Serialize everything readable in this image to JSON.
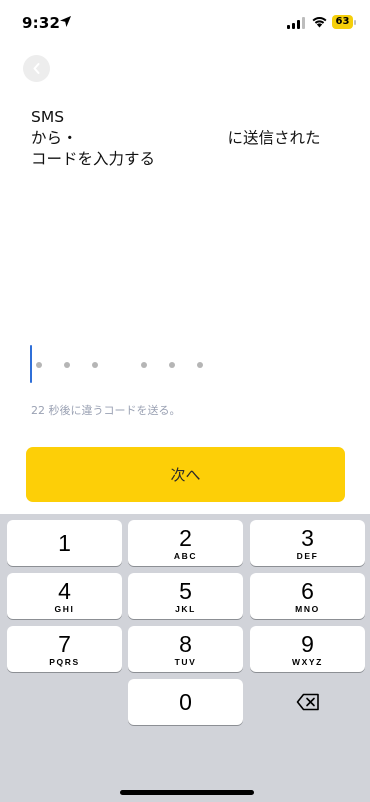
{
  "status_bar": {
    "time": "9:32",
    "battery_level": "63"
  },
  "heading": {
    "line1": "SMS",
    "line2_start": "から・",
    "line2_end": "に送信された",
    "line3": "コードを入力する"
  },
  "code_input": {
    "digit_count": 6,
    "filled_count": 0
  },
  "resend": {
    "text": "22 秒後に違うコードを送る。"
  },
  "next_button": {
    "label": "次へ"
  },
  "keypad": {
    "keys": [
      {
        "digit": "1",
        "letters": ""
      },
      {
        "digit": "2",
        "letters": "ABC"
      },
      {
        "digit": "3",
        "letters": "DEF"
      },
      {
        "digit": "4",
        "letters": "GHI"
      },
      {
        "digit": "5",
        "letters": "JKL"
      },
      {
        "digit": "6",
        "letters": "MNO"
      },
      {
        "digit": "7",
        "letters": "PQRS"
      },
      {
        "digit": "8",
        "letters": "TUV"
      },
      {
        "digit": "9",
        "letters": "WXYZ"
      },
      {
        "digit": "0",
        "letters": ""
      }
    ],
    "delete_icon": "backspace-icon"
  },
  "colors": {
    "accent": "#fdcf07",
    "cursor": "#2f6fd8",
    "battery": "#f5cf0a"
  }
}
